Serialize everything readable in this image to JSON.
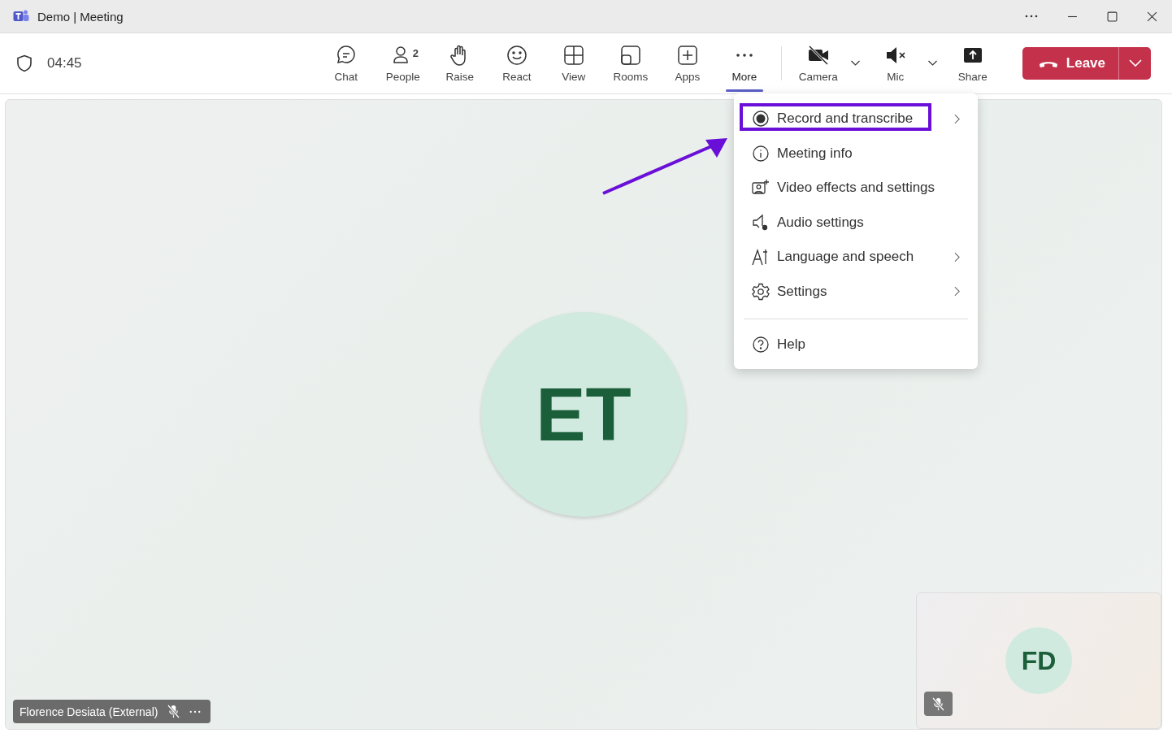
{
  "window": {
    "title": "Demo | Meeting"
  },
  "timer": "04:45",
  "toolbar": [
    {
      "kind": "chat",
      "label": "Chat",
      "selected": false
    },
    {
      "kind": "people",
      "label": "People",
      "count": "2",
      "selected": false
    },
    {
      "kind": "raise",
      "label": "Raise",
      "selected": false
    },
    {
      "kind": "react",
      "label": "React",
      "selected": false
    },
    {
      "kind": "view",
      "label": "View",
      "selected": false
    },
    {
      "kind": "rooms",
      "label": "Rooms",
      "selected": false
    },
    {
      "kind": "apps",
      "label": "Apps",
      "selected": false
    },
    {
      "kind": "more",
      "label": "More",
      "selected": true
    }
  ],
  "devices": [
    {
      "kind": "camera",
      "label": "Camera",
      "off": true
    },
    {
      "kind": "mic",
      "label": "Mic",
      "off": true
    }
  ],
  "share": {
    "label": "Share"
  },
  "leave": {
    "label": "Leave"
  },
  "menu": {
    "sections": [
      [
        {
          "kind": "record",
          "label": "Record and transcribe",
          "submenu": true,
          "highlighted": true
        },
        {
          "kind": "info",
          "label": "Meeting info",
          "submenu": false,
          "highlighted": false
        },
        {
          "kind": "video",
          "label": "Video effects and settings",
          "submenu": false,
          "highlighted": false
        },
        {
          "kind": "audio",
          "label": "Audio settings",
          "submenu": false,
          "highlighted": false
        },
        {
          "kind": "language",
          "label": "Language and speech",
          "submenu": true,
          "highlighted": false
        },
        {
          "kind": "settings",
          "label": "Settings",
          "submenu": true,
          "highlighted": false
        }
      ],
      [
        {
          "kind": "help",
          "label": "Help",
          "submenu": false,
          "highlighted": false
        }
      ]
    ]
  },
  "stage": {
    "initials": "ET",
    "name": "Florence Desiata (External)",
    "muted": true
  },
  "self_view": {
    "initials": "FD",
    "muted": true
  }
}
